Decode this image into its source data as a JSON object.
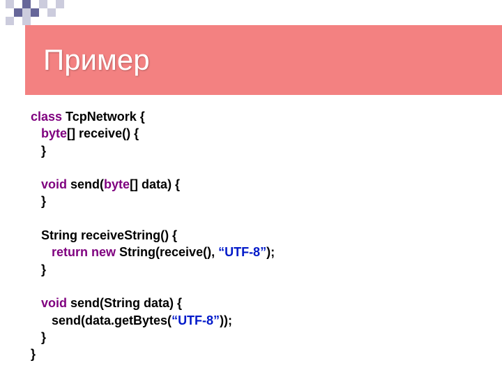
{
  "title": "Пример",
  "code": {
    "kw_class": "class",
    "class_decl": " TcpNetwork {",
    "kw_byte1": "byte",
    "receive_sig": "[] receive() {",
    "brace_close": "}",
    "kw_void1": "void",
    "send_bytes_a": " send(",
    "kw_byte2": "byte",
    "send_bytes_b": "[] data) {",
    "recvstr_sig": "String receiveString() {",
    "kw_return_new": "return new",
    "recvstr_body_a": " String(receive(), ",
    "utf8_1": "“UTF-8”",
    "recvstr_body_b": ");",
    "kw_void2": "void",
    "sendstr_sig": " send(String data) {",
    "sendstr_body_a": "send(data.getBytes(",
    "utf8_2": "“UTF-8”",
    "sendstr_body_b": "));"
  },
  "deco": {
    "dark": "#666699",
    "light": "#ccccdd",
    "white": "#ffffff"
  }
}
